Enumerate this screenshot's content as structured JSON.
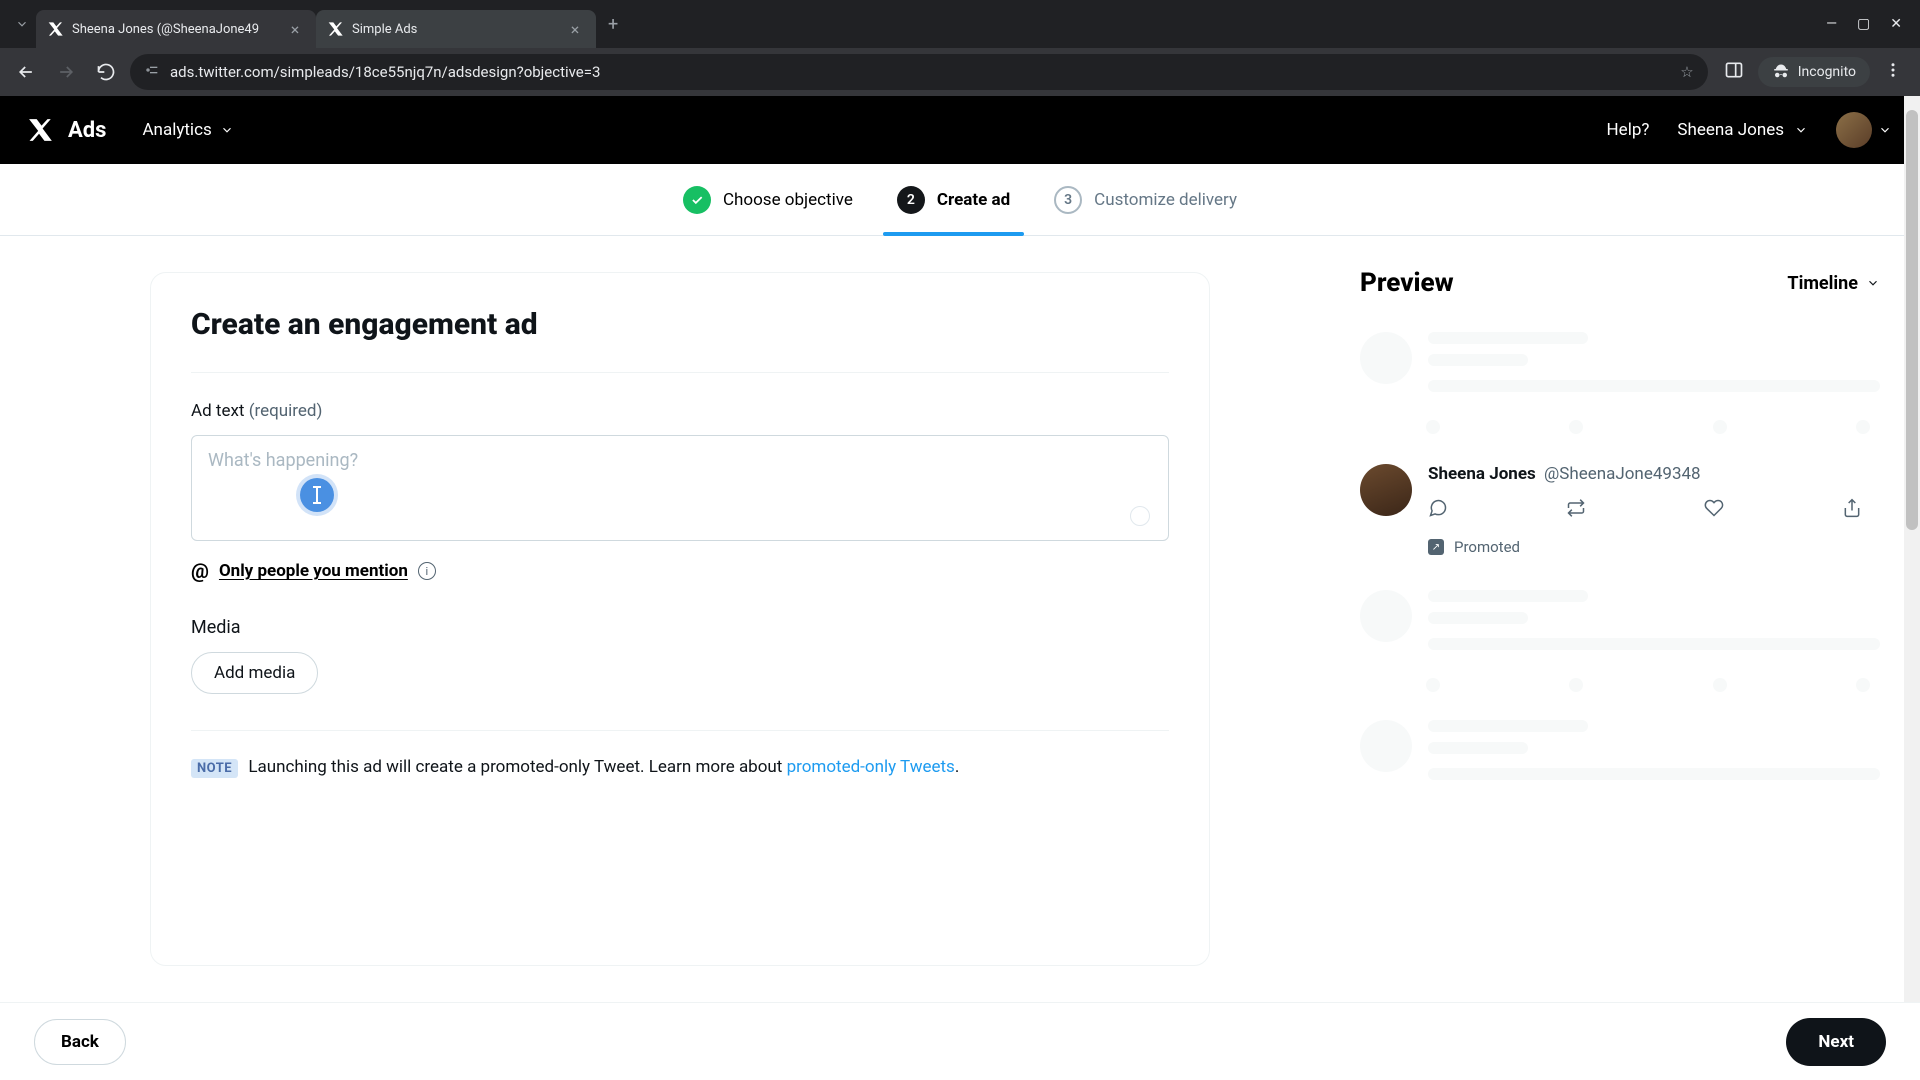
{
  "browser": {
    "tabs": [
      {
        "title": "Sheena Jones (@SheenaJone49"
      },
      {
        "title": "Simple Ads"
      }
    ],
    "url": "ads.twitter.com/simpleads/18ce55njq7n/adsdesign?objective=3",
    "incognito_label": "Incognito"
  },
  "header": {
    "brand": "Ads",
    "analytics": "Analytics",
    "help": "Help?",
    "user_name": "Sheena Jones"
  },
  "stepper": {
    "s1": "Choose objective",
    "s2": "Create ad",
    "s2_num": "2",
    "s3": "Customize delivery",
    "s3_num": "3"
  },
  "form": {
    "title": "Create an engagement ad",
    "ad_text_label": "Ad text ",
    "ad_text_required": "(required)",
    "placeholder": "What's happening?",
    "mention_text": "Only people you mention",
    "media_label": "Media",
    "add_media": "Add media",
    "note_badge": "NOTE",
    "note_text": "Launching this ad will create a promoted-only Tweet. Learn more about ",
    "note_link": "promoted-only Tweets",
    "note_period": "."
  },
  "preview": {
    "title": "Preview",
    "view_mode": "Timeline",
    "display_name": "Sheena Jones",
    "handle": "@SheenaJone49348",
    "promoted": "Promoted"
  },
  "footer": {
    "back": "Back",
    "next": "Next"
  }
}
